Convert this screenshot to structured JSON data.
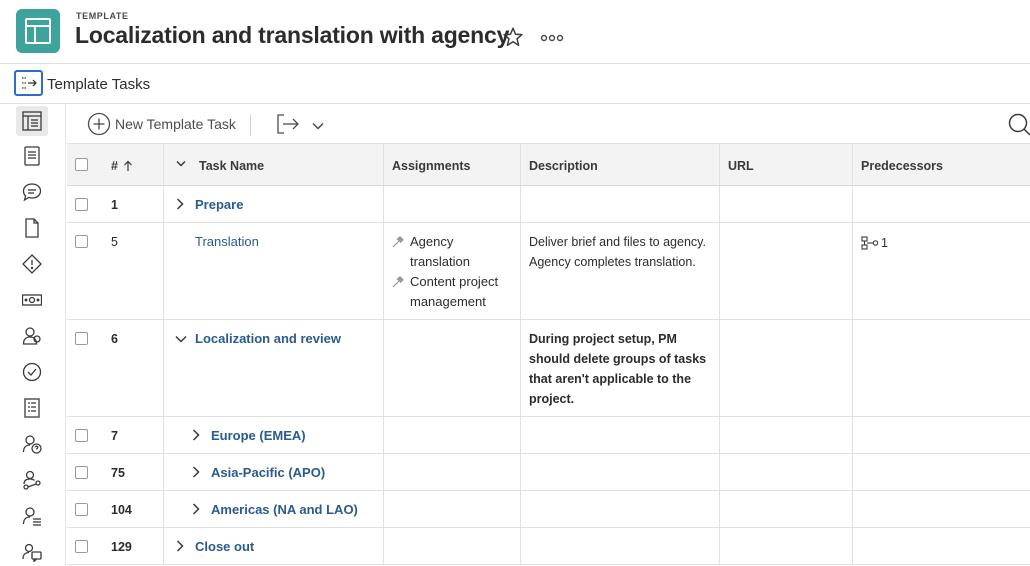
{
  "header": {
    "kicker": "TEMPLATE",
    "title": "Localization and translation with agency",
    "accent_color": "#3ea39c"
  },
  "subheader": {
    "title": "Template Tasks"
  },
  "rail": {
    "icons": [
      "task-list-icon",
      "document-icon",
      "chat-icon",
      "file-icon",
      "issue-icon",
      "money-icon",
      "people-icon",
      "check-circle-icon",
      "list-icon",
      "user-question-icon",
      "workflow-icon",
      "user-list-icon",
      "user-chat-icon"
    ]
  },
  "toolbar": {
    "new_task_label": "New Template Task"
  },
  "table": {
    "headers": {
      "num": "#",
      "task_name": "Task Name",
      "assignments": "Assignments",
      "description": "Description",
      "url": "URL",
      "predecessors": "Predecessors"
    },
    "rows": [
      {
        "num": "1",
        "name": "Prepare"
      },
      {
        "num": "5",
        "name": "Translation",
        "assignments": [
          "Agency",
          "translation",
          "Content project",
          "management"
        ],
        "description": "Deliver brief and files to agency. Agency completes translation.",
        "predecessor": "1"
      },
      {
        "num": "6",
        "name": "Localization and review",
        "description": "During project setup, PM should delete groups of tasks that aren't applicable to the project."
      },
      {
        "num": "7",
        "name": "Europe (EMEA)"
      },
      {
        "num": "75",
        "name": "Asia-Pacific (APO)"
      },
      {
        "num": "104",
        "name": "Americas (NA and LAO)"
      },
      {
        "num": "129",
        "name": "Close out"
      }
    ]
  }
}
